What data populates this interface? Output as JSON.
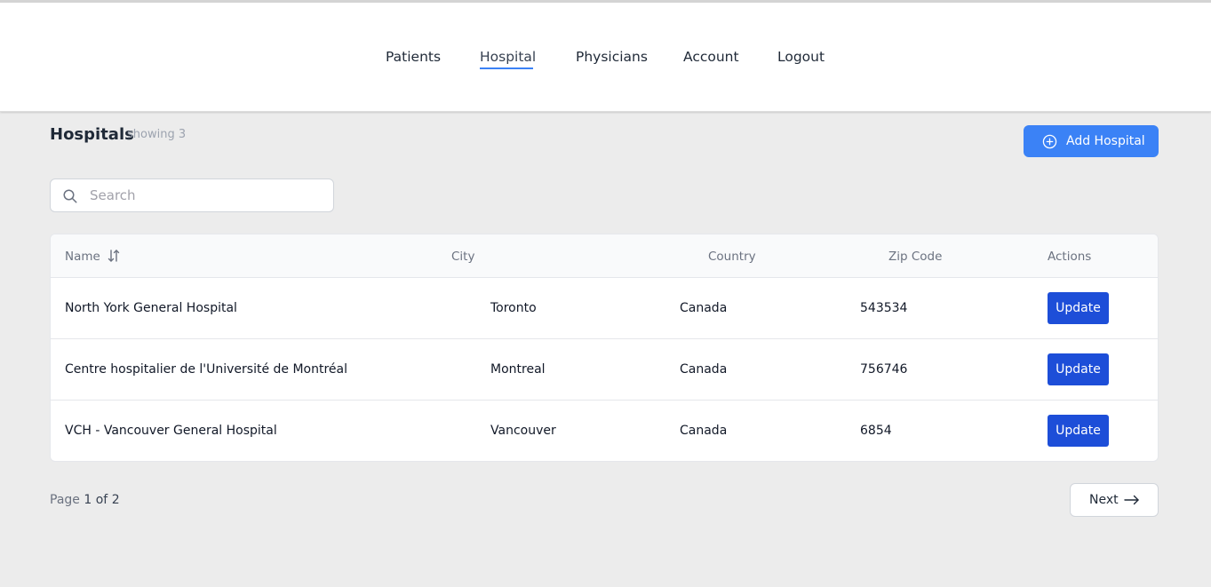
{
  "nav": {
    "items": [
      {
        "label": "Patients"
      },
      {
        "label": "Hospital",
        "active": true
      },
      {
        "label": "Physicians"
      },
      {
        "label": "Account"
      },
      {
        "label": "Logout"
      }
    ]
  },
  "page": {
    "title": "Hospitals",
    "showing": "showing 3",
    "add_button": "Add Hospital"
  },
  "search": {
    "placeholder": "Search",
    "value": ""
  },
  "table": {
    "columns": [
      "Name",
      "City",
      "Country",
      "Zip Code",
      "Actions"
    ],
    "rows": [
      {
        "name": "North York General Hospital",
        "city": "Toronto",
        "country": "Canada",
        "zip": "543534",
        "action": "Update"
      },
      {
        "name": "Centre hospitalier de l'Université de Montréal",
        "city": "Montreal",
        "country": "Canada",
        "zip": "756746",
        "action": "Update"
      },
      {
        "name": "VCH - Vancouver General Hospital",
        "city": "Vancouver",
        "country": "Canada",
        "zip": "6854",
        "action": "Update"
      }
    ]
  },
  "pagination": {
    "page_label": "Page",
    "current": "1",
    "of_label": "of",
    "total": "2",
    "next_label": "Next"
  },
  "colors": {
    "primary": "#3b82f6",
    "update_button": "#1d4ed8",
    "background": "#ececec"
  },
  "icons": {
    "add": "plus-circle-icon",
    "search": "search-icon",
    "sort": "sort-icon",
    "next": "arrow-right-icon"
  }
}
